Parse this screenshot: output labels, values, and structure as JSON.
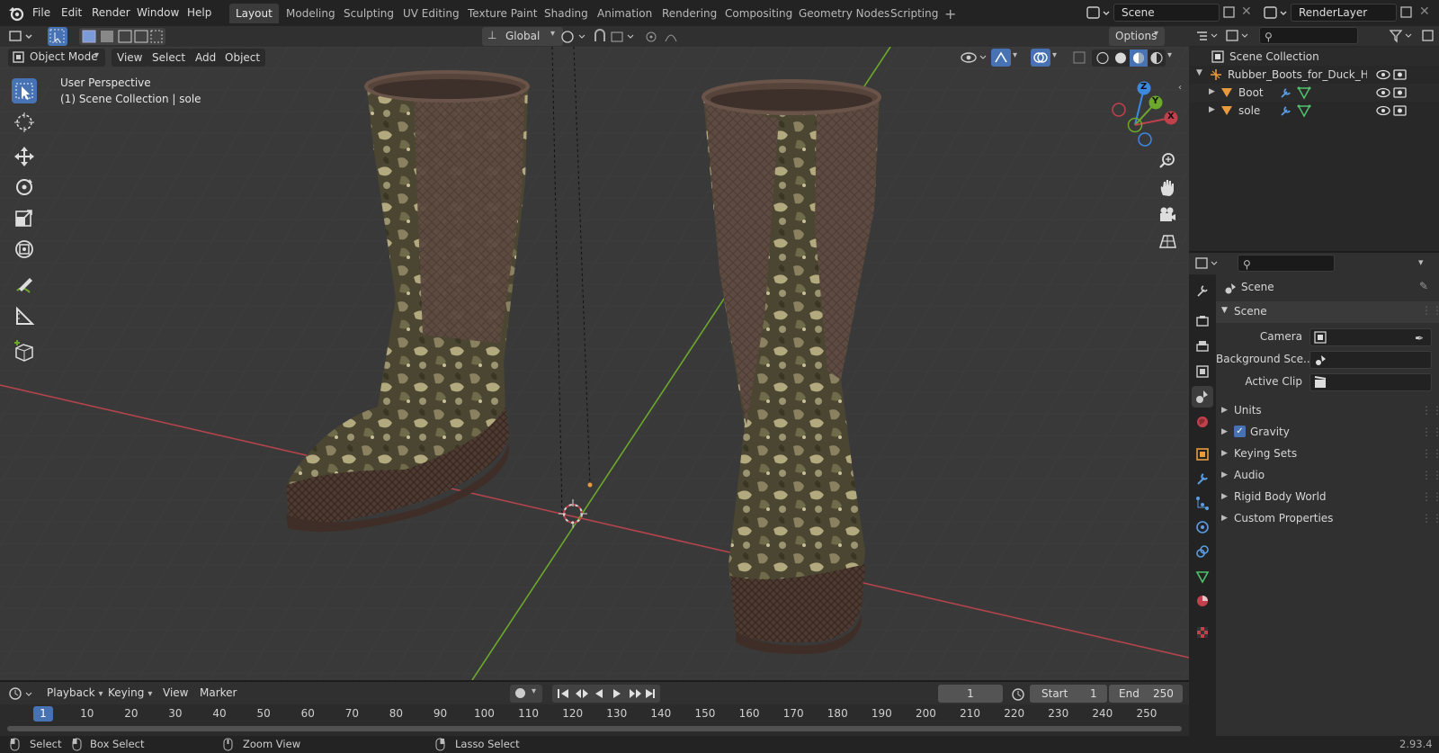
{
  "menus": [
    "File",
    "Edit",
    "Render",
    "Window",
    "Help"
  ],
  "workspaces": [
    "Layout",
    "Modeling",
    "Sculpting",
    "UV Editing",
    "Texture Paint",
    "Shading",
    "Animation",
    "Rendering",
    "Compositing",
    "Geometry Nodes",
    "Scripting"
  ],
  "scene_name": "Scene",
  "view_layer": "RenderLayer",
  "viewport": {
    "transform_orientation": "Global",
    "options_label": "Options",
    "mode": "Object Mode",
    "menus": [
      "View",
      "Select",
      "Add",
      "Object"
    ],
    "overlay_line1": "User Perspective",
    "overlay_line2": "(1) Scene Collection | sole",
    "gizmo": {
      "z": "Z",
      "y": "Y",
      "x": "X"
    }
  },
  "outliner": {
    "root": "Scene Collection",
    "collection": "Rubber_Boots_for_Duck_Hunt",
    "objects": [
      "Boot",
      "sole"
    ]
  },
  "properties": {
    "context": "Scene",
    "panel_title": "Scene",
    "camera_label": "Camera",
    "bg_scene_label": "Background Sce...",
    "active_clip_label": "Active Clip",
    "collapsed_panels": [
      "Units",
      "Gravity",
      "Keying Sets",
      "Audio",
      "Rigid Body World",
      "Custom Properties"
    ],
    "gravity_checked": true
  },
  "timeline": {
    "menus": [
      "Playback",
      "Keying",
      "View",
      "Marker"
    ],
    "current_frame": "1",
    "start_label": "Start",
    "start_value": "1",
    "end_label": "End",
    "end_value": "250",
    "ticks": [
      "1",
      "10",
      "20",
      "30",
      "40",
      "50",
      "60",
      "70",
      "80",
      "90",
      "100",
      "110",
      "120",
      "130",
      "140",
      "150",
      "160",
      "170",
      "180",
      "190",
      "200",
      "210",
      "220",
      "230",
      "240",
      "250"
    ]
  },
  "statusbar": {
    "select": "Select",
    "box_select": "Box Select",
    "zoom_view": "Zoom View",
    "lasso_select": "Lasso Select",
    "version": "2.93.4"
  },
  "colors": {
    "accent": "#4772b3",
    "x_axis": "#c0414b",
    "y_axis": "#6ba82b",
    "z_axis": "#3c8ae0",
    "bg": "#393939",
    "object_orange": "#e89a3c"
  },
  "icons": [
    "blender-logo-icon",
    "editor-type-icon",
    "select-box-icon",
    "cursor-icon",
    "move-icon",
    "rotate-icon",
    "scale-icon",
    "transform-icon",
    "annotate-icon",
    "measure-icon",
    "add-cube-icon",
    "zoom-icon",
    "hand-icon",
    "camera-icon",
    "grid-icon",
    "eye-icon",
    "camera-render-icon",
    "search-icon",
    "filter-icon",
    "pin-icon",
    "play-icon",
    "checkbox-icon"
  ]
}
